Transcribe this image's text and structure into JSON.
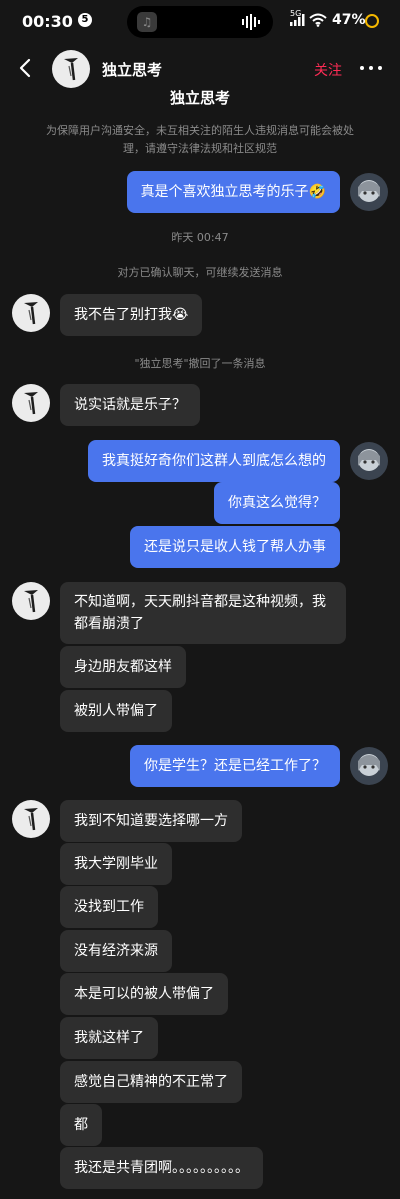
{
  "status": {
    "time": "00:30",
    "notif_count": "5",
    "network": "5G",
    "battery": "47%"
  },
  "header": {
    "name": "独立思考",
    "follow": "关注"
  },
  "chat_title": "独立思考",
  "notice": "为保障用户沟通安全，未互相关注的陌生人违规消息可能会被处理，请遵守法律法规和社区规范",
  "messages": {
    "m1": "真是个喜欢独立思考的乐子🤣",
    "t1": "昨天 00:47",
    "s1": "对方已确认聊天，可继续发送消息",
    "m2": "我不告了别打我😭",
    "s2": "\"独立思考\"撤回了一条消息",
    "m3": "说实话就是乐子？",
    "m4": "我真挺好奇你们这群人到底怎么想的",
    "m5": "你真这么觉得？",
    "m6": "还是说只是收人钱了帮人办事",
    "m7": "不知道啊，天天刷抖音都是这种视频，我都看崩溃了",
    "m8": "身边朋友都这样",
    "m9": "被别人带偏了",
    "m10": "你是学生？还是已经工作了？",
    "m11": "我到不知道要选择哪一方",
    "m12": "我大学刚毕业",
    "m13": "没找到工作",
    "m14": "没有经济来源",
    "m15": "本是可以的被人带偏了",
    "m16": "我就这样了",
    "m17": "感觉自己精神的不正常了",
    "m18": "都",
    "m19": "我还是共青团啊。。。。。。。。。。"
  }
}
